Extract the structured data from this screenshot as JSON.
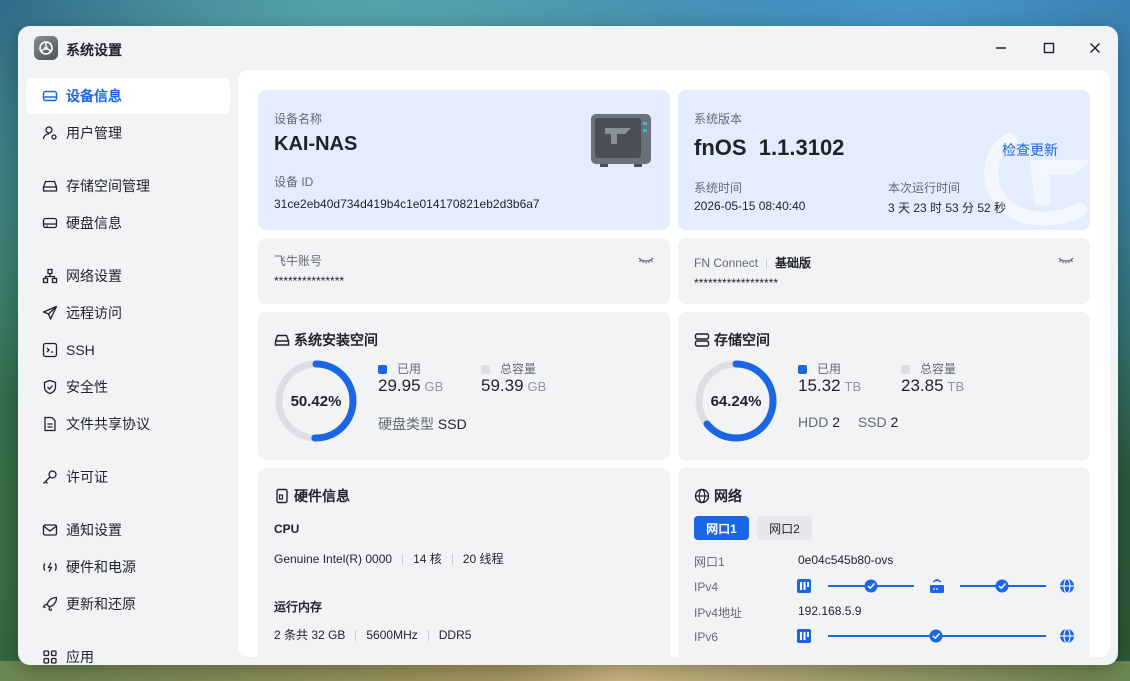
{
  "window": {
    "title": "系统设置"
  },
  "sidebar": {
    "items": [
      {
        "label": "设备信息",
        "icon": "device-icon"
      },
      {
        "label": "用户管理",
        "icon": "user-icon"
      },
      {
        "label": "存储空间管理",
        "icon": "storage-icon"
      },
      {
        "label": "硬盘信息",
        "icon": "disk-icon"
      },
      {
        "label": "网络设置",
        "icon": "network-icon"
      },
      {
        "label": "远程访问",
        "icon": "send-icon"
      },
      {
        "label": "SSH",
        "icon": "terminal-icon"
      },
      {
        "label": "安全性",
        "icon": "shield-icon"
      },
      {
        "label": "文件共享协议",
        "icon": "file-icon"
      },
      {
        "label": "许可证",
        "icon": "key-icon"
      },
      {
        "label": "通知设置",
        "icon": "mail-icon"
      },
      {
        "label": "硬件和电源",
        "icon": "power-icon"
      },
      {
        "label": "更新和还原",
        "icon": "rocket-icon"
      },
      {
        "label": "应用",
        "icon": "apps-icon"
      }
    ]
  },
  "device": {
    "name_label": "设备名称",
    "name": "KAI-NAS",
    "id_label": "设备 ID",
    "id": "31ce2eb40d734d419b4c1e014170821eb2d3b6a7"
  },
  "system": {
    "version_label": "系统版本",
    "version": "fnOS  1.1.3102",
    "check_update": "检查更新",
    "time_label": "系统时间",
    "time": "2026-05-15 08:40:40",
    "uptime_label": "本次运行时间",
    "uptime": "3 天 23 时 53 分 52 秒"
  },
  "account": {
    "label": "飞牛账号",
    "value": "***************"
  },
  "fnconnect": {
    "label": "FN Connect",
    "edition": "基础版",
    "value": "******************"
  },
  "sys_space": {
    "title": "系统安装空间",
    "percent_text": "50.42%",
    "fraction": 0.5042,
    "used_label": "已用",
    "used": "29.95",
    "used_unit": "GB",
    "total_label": "总容量",
    "total": "59.39",
    "total_unit": "GB",
    "disk_type_label": "硬盘类型",
    "disk_type": "SSD"
  },
  "storage": {
    "title": "存储空间",
    "percent_text": "64.24%",
    "fraction": 0.6424,
    "used_label": "已用",
    "used": "15.32",
    "used_unit": "TB",
    "total_label": "总容量",
    "total": "23.85",
    "total_unit": "TB",
    "hdd_label": "HDD",
    "hdd": "2",
    "ssd_label": "SSD",
    "ssd": "2"
  },
  "hardware": {
    "title": "硬件信息",
    "cpu_label": "CPU",
    "cpu_model": "Genuine Intel(R) 0000",
    "cpu_cores": "14 核",
    "cpu_threads": "20 线程",
    "mem_label": "运行内存",
    "mem_slots": "2 条共 32 GB",
    "mem_speed": "5600MHz",
    "mem_type": "DDR5"
  },
  "network": {
    "title": "网络",
    "tabs": [
      "网口1",
      "网口2"
    ],
    "port_label": "网口1",
    "port_value": "0e04c545b80-ovs",
    "ipv4_label": "IPv4",
    "ipv4_addr_label": "IPv4地址",
    "ipv4_addr": "192.168.5.9",
    "ipv6_label": "IPv6"
  },
  "colors": {
    "accent": "#1a66e5",
    "track": "#dcdee2",
    "card": "#f2f3f5",
    "card_blue": "#e3edfd"
  }
}
